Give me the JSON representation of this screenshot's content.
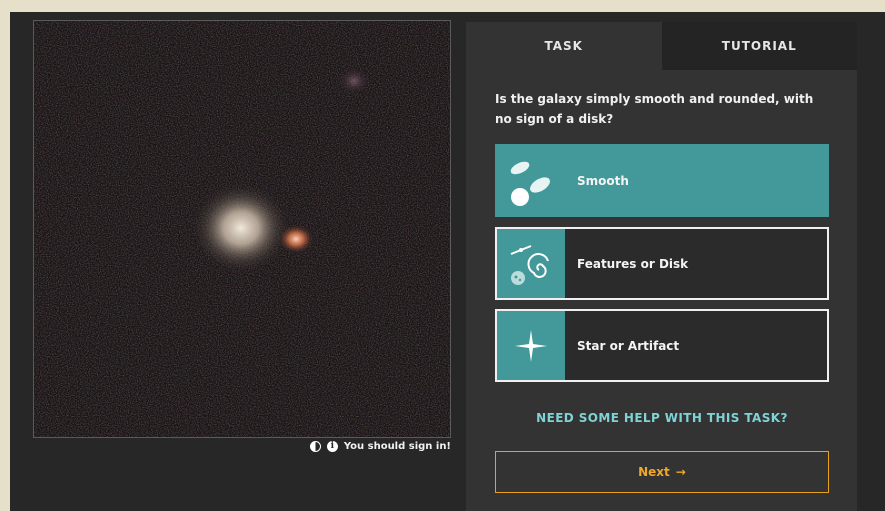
{
  "subject": {
    "image_description": "galaxy-subject-image"
  },
  "meta": {
    "contrast_icon": "contrast-icon",
    "info_icon": "info-icon",
    "sign_in_text": "You should sign in!"
  },
  "tabs": [
    {
      "label": "TASK",
      "active": true
    },
    {
      "label": "TUTORIAL",
      "active": false
    }
  ],
  "task": {
    "question": "Is the galaxy simply smooth and rounded, with no sign of a disk?",
    "answers": [
      {
        "label": "Smooth",
        "icon": "smooth-galaxy-icon",
        "selected": true
      },
      {
        "label": "Features or Disk",
        "icon": "spiral-galaxy-icon",
        "selected": false
      },
      {
        "label": "Star or Artifact",
        "icon": "star-icon",
        "selected": false
      }
    ],
    "help_label": "NEED SOME HELP WITH THIS TASK?",
    "next_label": "Next",
    "next_arrow": "→"
  },
  "colors": {
    "page_bg": "#e6dfc9",
    "frame_bg": "#272727",
    "panel_bg": "#333333",
    "teal": "#43989a",
    "help_text": "#7fd3d6",
    "next_accent": "#f0a82a"
  }
}
